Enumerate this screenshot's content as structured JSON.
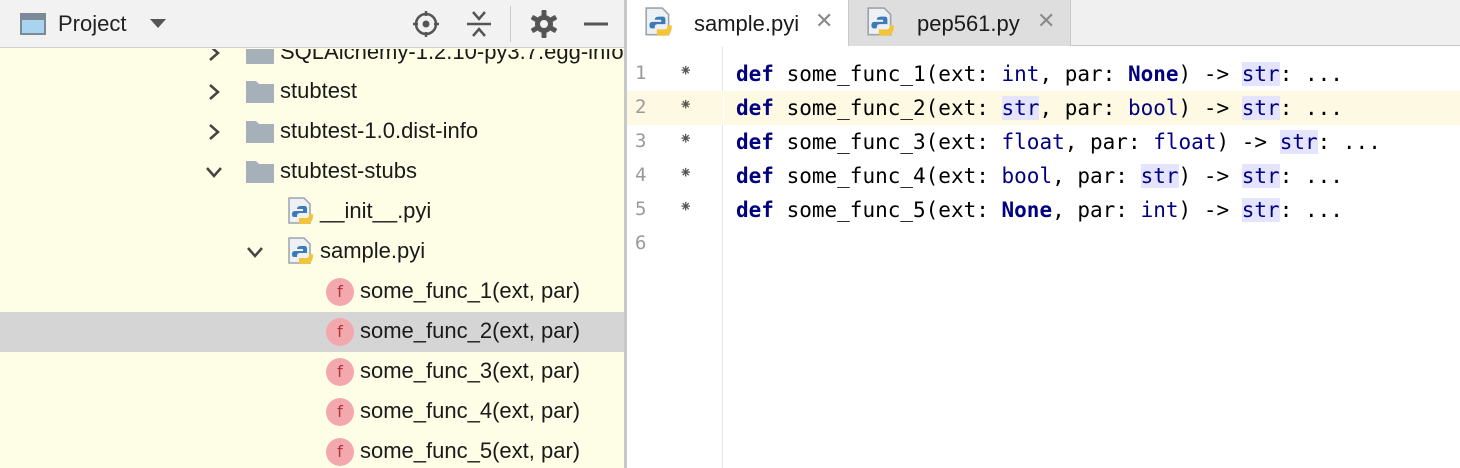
{
  "project": {
    "title": "Project",
    "tree": [
      {
        "label": "SQLAlchemy-1.2.10-py3.7.egg-info"
      },
      {
        "label": "stubtest"
      },
      {
        "label": "stubtest-1.0.dist-info"
      },
      {
        "label": "stubtest-stubs"
      },
      {
        "label": "__init__.pyi"
      },
      {
        "label": "sample.pyi"
      },
      {
        "label": "some_func_1(ext, par)"
      },
      {
        "label": "some_func_2(ext, par)"
      },
      {
        "label": "some_func_3(ext, par)"
      },
      {
        "label": "some_func_4(ext, par)"
      },
      {
        "label": "some_func_5(ext, par)"
      }
    ],
    "function_icon_letter": "f"
  },
  "tabs": [
    {
      "label": "sample.pyi",
      "close": "✕"
    },
    {
      "label": "pep561.py",
      "close": "✕"
    }
  ],
  "gutter": {
    "mark": "⁕",
    "lines": [
      "1",
      "2",
      "3",
      "4",
      "5",
      "6"
    ]
  },
  "code": {
    "lines": [
      [
        {
          "t": "def",
          "c": "kw"
        },
        {
          "t": " some_func_1(ext: "
        },
        {
          "t": "int",
          "c": "ty"
        },
        {
          "t": ", par: "
        },
        {
          "t": "None",
          "c": "kw"
        },
        {
          "t": ") -> "
        },
        {
          "t": "str",
          "c": "ty hl"
        },
        {
          "t": ": ..."
        }
      ],
      [
        {
          "t": "def",
          "c": "kw"
        },
        {
          "t": " some_func_2(ext: "
        },
        {
          "t": "str",
          "c": "ty hl"
        },
        {
          "t": ", par: "
        },
        {
          "t": "bool",
          "c": "ty"
        },
        {
          "t": ") -> "
        },
        {
          "t": "str",
          "c": "ty hl"
        },
        {
          "t": ": ..."
        }
      ],
      [
        {
          "t": "def",
          "c": "kw"
        },
        {
          "t": " some_func_3(ext: "
        },
        {
          "t": "float",
          "c": "ty"
        },
        {
          "t": ", par: "
        },
        {
          "t": "float",
          "c": "ty"
        },
        {
          "t": ") -> "
        },
        {
          "t": "str",
          "c": "ty hl"
        },
        {
          "t": ": ..."
        }
      ],
      [
        {
          "t": "def",
          "c": "kw"
        },
        {
          "t": " some_func_4(ext: "
        },
        {
          "t": "bool",
          "c": "ty"
        },
        {
          "t": ", par: "
        },
        {
          "t": "str",
          "c": "ty hl"
        },
        {
          "t": ") -> "
        },
        {
          "t": "str",
          "c": "ty hl"
        },
        {
          "t": ": ..."
        }
      ],
      [
        {
          "t": "def",
          "c": "kw"
        },
        {
          "t": " some_func_5(ext: "
        },
        {
          "t": "None",
          "c": "kw"
        },
        {
          "t": ", par: "
        },
        {
          "t": "int",
          "c": "ty"
        },
        {
          "t": ") -> "
        },
        {
          "t": "str",
          "c": "ty hl"
        },
        {
          "t": ": ..."
        }
      ],
      []
    ]
  },
  "colors": {
    "project_bg": "#fefde6",
    "selected_row": "#d5d5d5",
    "current_line": "#fdf9e2",
    "keyword": "#000080",
    "highlight": "#e4e4ff"
  }
}
